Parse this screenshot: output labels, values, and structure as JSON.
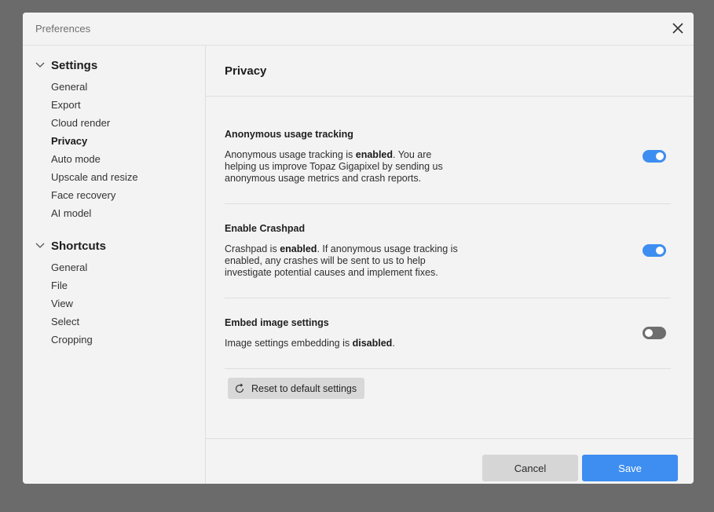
{
  "window": {
    "title": "Preferences",
    "close_icon": "close-icon"
  },
  "sidebar": {
    "groups": [
      {
        "label": "Settings",
        "items": [
          "General",
          "Export",
          "Cloud render",
          "Privacy",
          "Auto mode",
          "Upscale and resize",
          "Face recovery",
          "AI model"
        ],
        "active": "Privacy"
      },
      {
        "label": "Shortcuts",
        "items": [
          "General",
          "File",
          "View",
          "Select",
          "Cropping"
        ]
      }
    ]
  },
  "content": {
    "heading": "Privacy",
    "settings": [
      {
        "title": "Anonymous usage tracking",
        "desc_pre": "Anonymous usage tracking is ",
        "desc_bold": "enabled",
        "desc_post": ". You are helping us improve Topaz Gigapixel by sending us anonymous usage metrics and crash reports.",
        "enabled": true
      },
      {
        "title": "Enable Crashpad",
        "desc_pre": "Crashpad is ",
        "desc_bold": "enabled",
        "desc_post": ". If anonymous usage tracking is enabled, any crashes will be sent to us to help investigate potential causes and implement fixes.",
        "enabled": true
      },
      {
        "title": "Embed image settings",
        "desc_pre": "Image settings embedding is ",
        "desc_bold": "disabled",
        "desc_post": ".",
        "enabled": false
      }
    ],
    "reset_label": "Reset to default settings"
  },
  "footer": {
    "cancel_label": "Cancel",
    "save_label": "Save"
  },
  "colors": {
    "accent": "#3d8ef0",
    "toggle_off": "#6e6e6e",
    "backdrop": "#6b6b6b"
  }
}
